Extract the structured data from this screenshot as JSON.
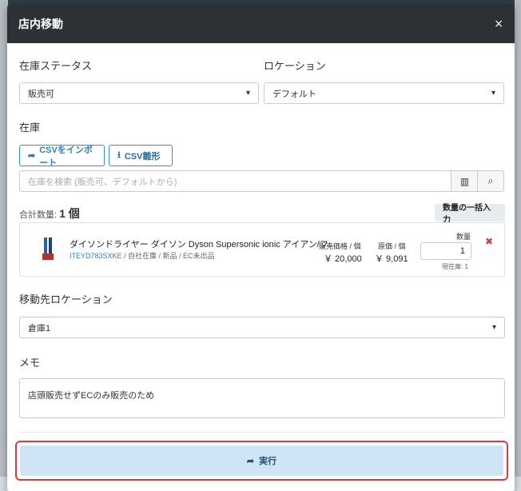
{
  "modal": {
    "title": "店内移動",
    "close_icon": "×"
  },
  "stock_status": {
    "label": "在庫ステータス",
    "value": "販売可"
  },
  "location": {
    "label": "ロケーション",
    "value": "デフォルト"
  },
  "inventory": {
    "label": "在庫",
    "import_csv_label": "CSVをインポート",
    "csv_format_label": "CSV雛形",
    "search_placeholder": "在庫を検索 (販売可、デフォルトから)"
  },
  "total": {
    "label": "合計数量:",
    "value": "1 個",
    "bulk_button": "数量の一括入力"
  },
  "item": {
    "title": "ダイソンドライヤー ダイソン Dyson Supersonic ionic アイアン/フ...",
    "code": "ITEYD783SXKE",
    "meta": "/ 自社在庫 / 新品 / EC未出品",
    "sale_price_label": "販売価格 / 個",
    "sale_price": "￥ 20,000",
    "cost_label": "原価 / 個",
    "cost": "￥ 9,091",
    "qty_label": "数量",
    "qty_value": "1",
    "current_stock": "現在庫: 1"
  },
  "destination": {
    "label": "移動先ロケーション",
    "value": "倉庫1"
  },
  "memo": {
    "label": "メモ",
    "value": "店頭販売せずECのみ販売のため"
  },
  "execute": {
    "label": "実行"
  },
  "colors": {
    "header_bg": "#2c3136",
    "accent": "#2f8fd1",
    "execute_bg": "#cfe5f6",
    "highlight": "#e03a3a",
    "delete": "#d9393e"
  }
}
